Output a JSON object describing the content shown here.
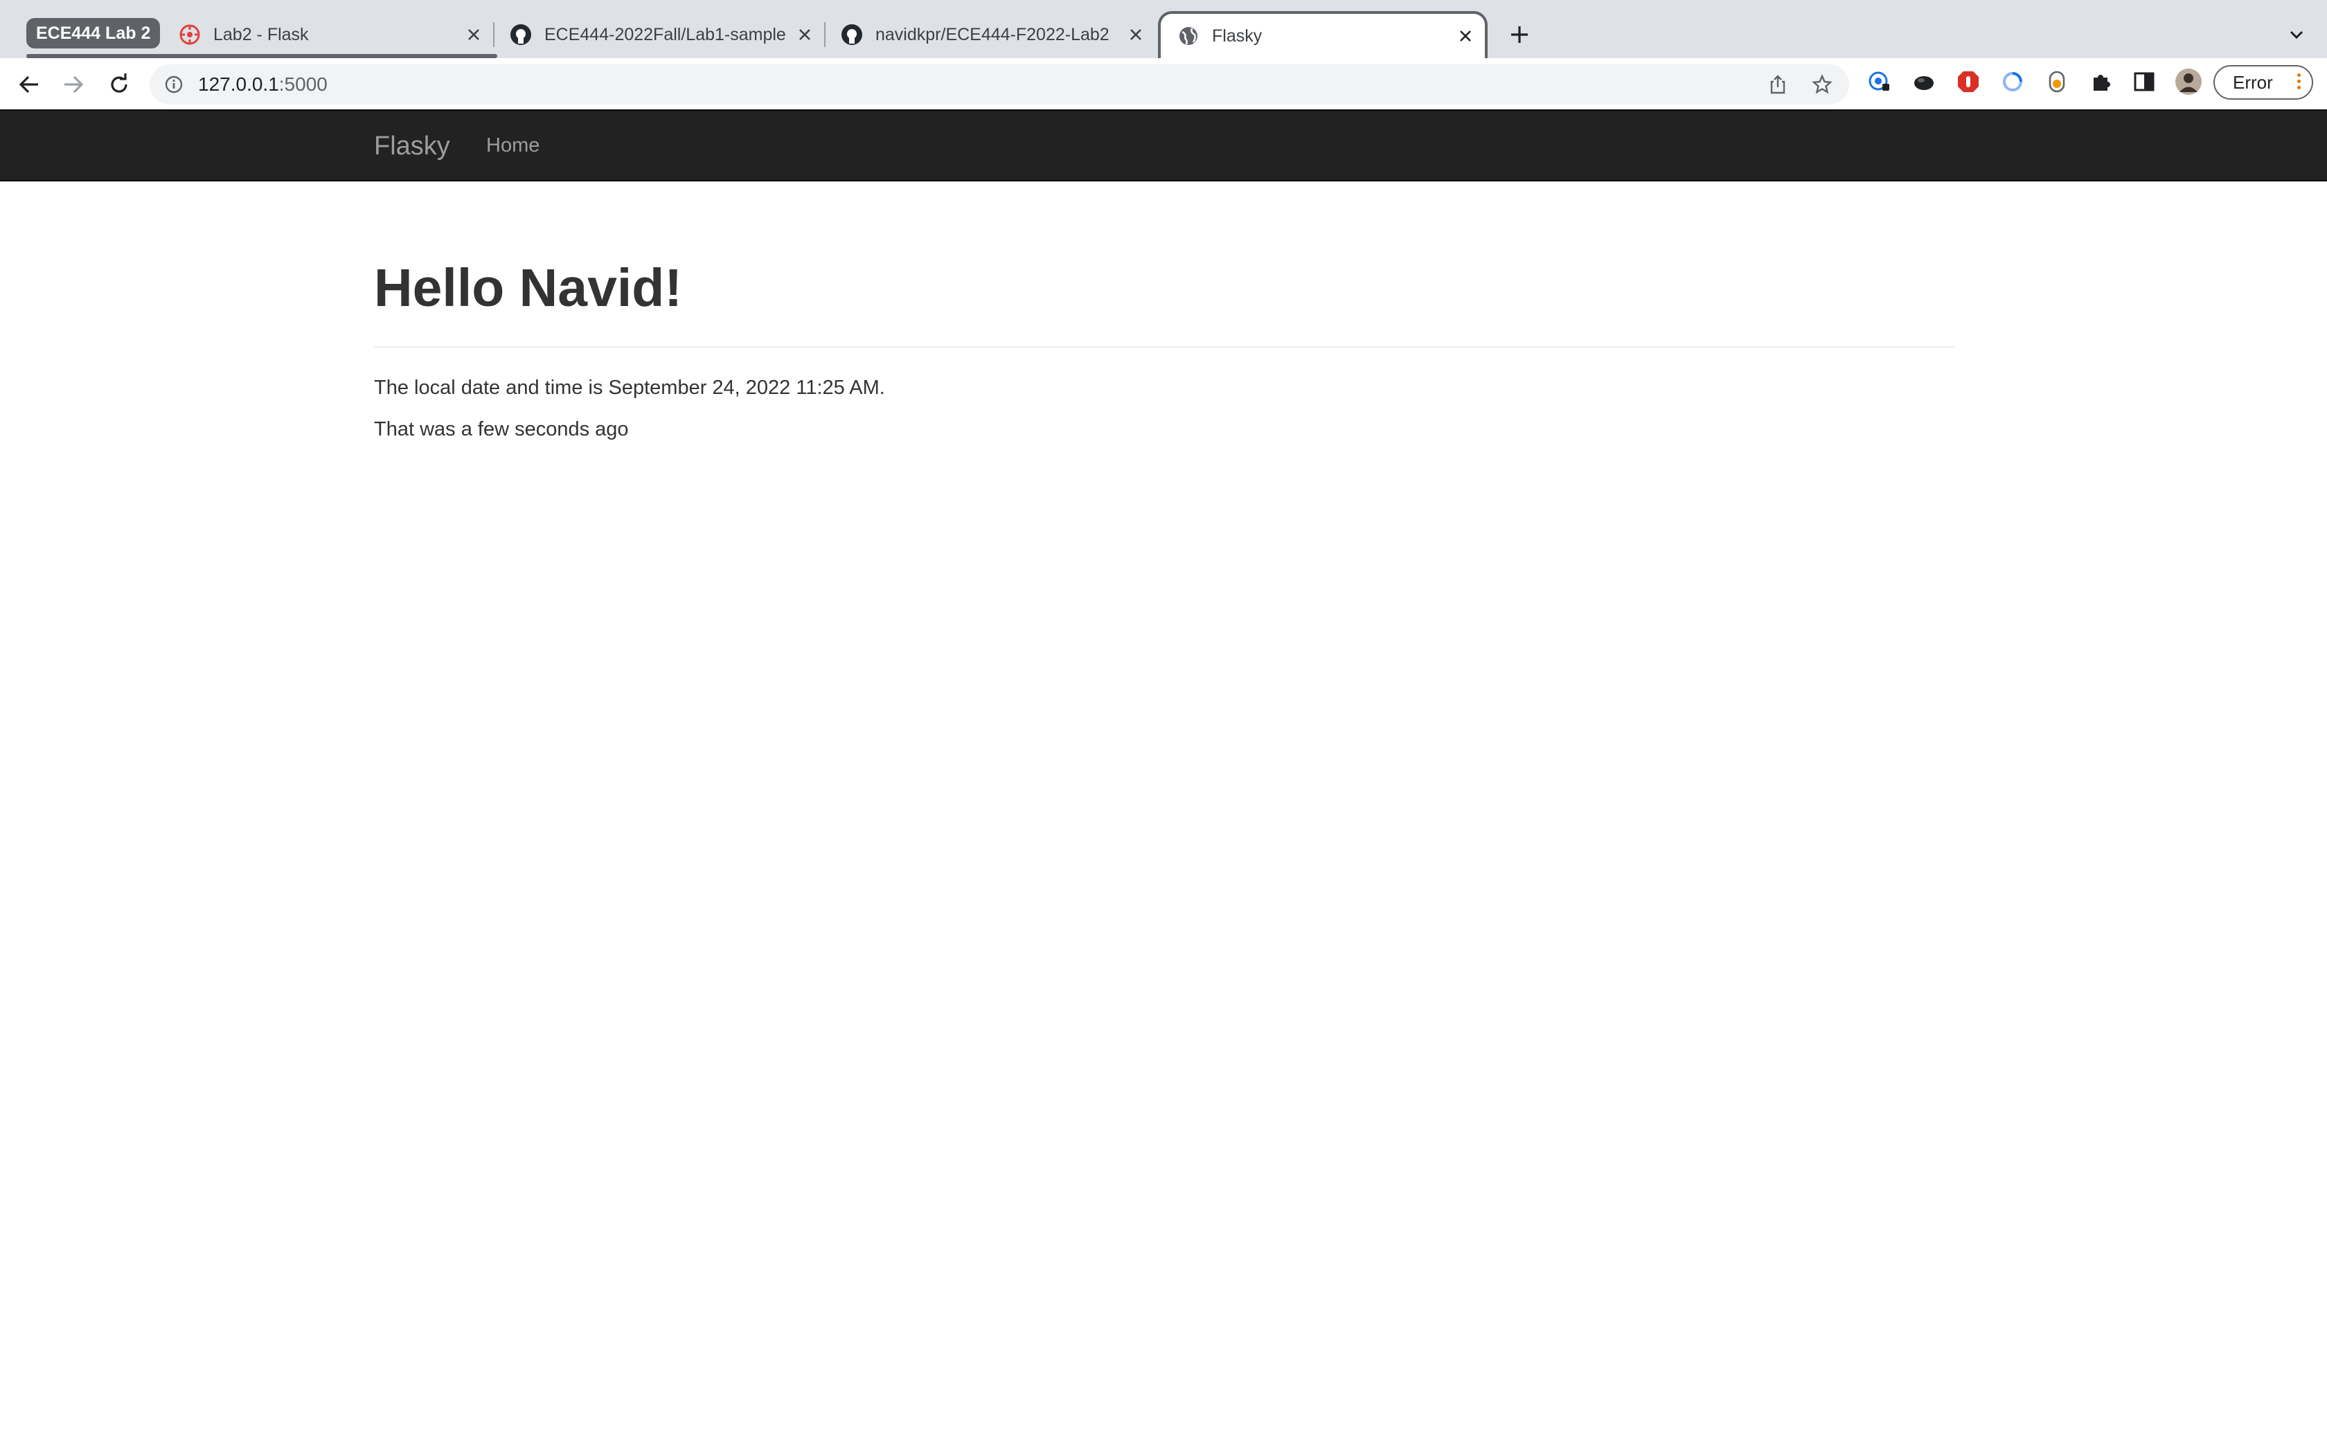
{
  "browser": {
    "tab_group_label": "ECE444 Lab 2",
    "tabs": [
      {
        "title": "Lab2 - Flask"
      },
      {
        "title": "ECE444-2022Fall/Lab1-sample"
      },
      {
        "title": "navidkpr/ECE444-F2022-Lab2"
      },
      {
        "title": "Flasky"
      }
    ],
    "url_host": "127.0.0.1",
    "url_port": ":5000",
    "profile_button_label": "Error"
  },
  "page": {
    "navbar": {
      "brand": "Flasky",
      "home_link": "Home"
    },
    "greeting": "Hello Navid!",
    "local_time_text": "The local date and time is September 24, 2022 11:25 AM.",
    "relative_time_text": "That was a few seconds ago"
  },
  "colors": {
    "navbar_bg": "#222222",
    "navbar_text": "#9d9d9d",
    "heading_text": "#333333",
    "tabstrip_bg": "#dee1e6",
    "tab_group": "#5f6368"
  }
}
